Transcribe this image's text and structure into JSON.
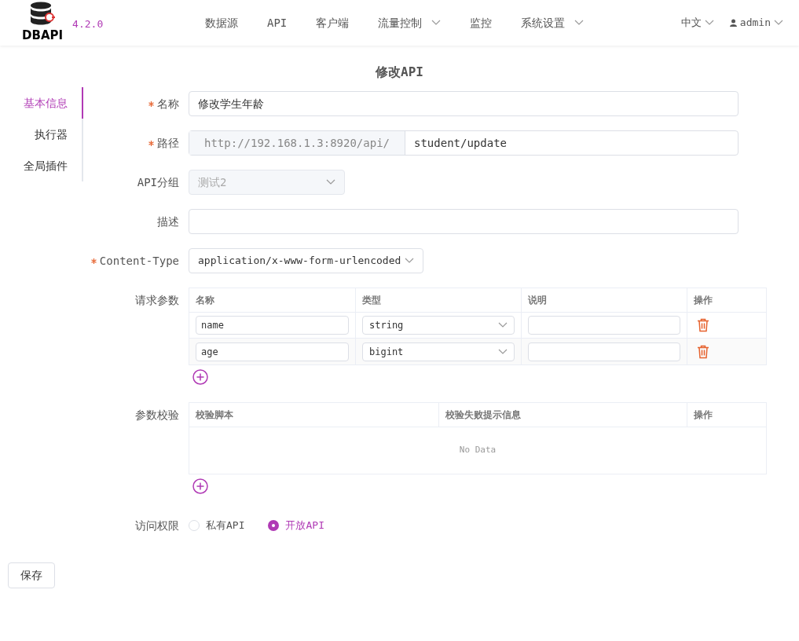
{
  "header": {
    "logo_text": "DBAPI",
    "version": "4.2.0",
    "nav": [
      {
        "label": "数据源",
        "has_menu": false
      },
      {
        "label": "API",
        "has_menu": false
      },
      {
        "label": "客户端",
        "has_menu": false
      },
      {
        "label": "流量控制",
        "has_menu": true
      },
      {
        "label": "监控",
        "has_menu": false
      },
      {
        "label": "系统设置",
        "has_menu": true
      }
    ],
    "language": "中文",
    "user": "admin"
  },
  "page_title": "修改API",
  "side_nav": [
    {
      "label": "基本信息",
      "selected": true
    },
    {
      "label": "执行器",
      "selected": false
    },
    {
      "label": "全局插件",
      "selected": false
    }
  ],
  "form": {
    "name": {
      "label": "名称",
      "required": true,
      "value": "修改学生年龄"
    },
    "path": {
      "label": "路径",
      "required": true,
      "prefix": "http://192.168.1.3:8920/api/",
      "value": "student/update"
    },
    "group": {
      "label": "API分组",
      "required": false,
      "value": "测试2",
      "disabled": true
    },
    "description": {
      "label": "描述",
      "required": false
    },
    "content_type": {
      "label": "Content-Type",
      "required": true,
      "value": "application/x-www-form-urlencoded"
    },
    "params": {
      "label": "请求参数",
      "columns": [
        "名称",
        "类型",
        "说明",
        "操作"
      ],
      "rows": [
        {
          "name": "name",
          "type": "string"
        },
        {
          "name": "age",
          "type": "bigint"
        }
      ]
    },
    "validation": {
      "label": "参数校验",
      "columns": [
        "校验脚本",
        "校验失败提示信息",
        "操作"
      ],
      "empty_text": "No Data"
    },
    "access": {
      "label": "访问权限",
      "options": [
        {
          "label": "私有API",
          "selected": false
        },
        {
          "label": "开放API",
          "selected": true
        }
      ]
    }
  },
  "save_button": "保存"
}
